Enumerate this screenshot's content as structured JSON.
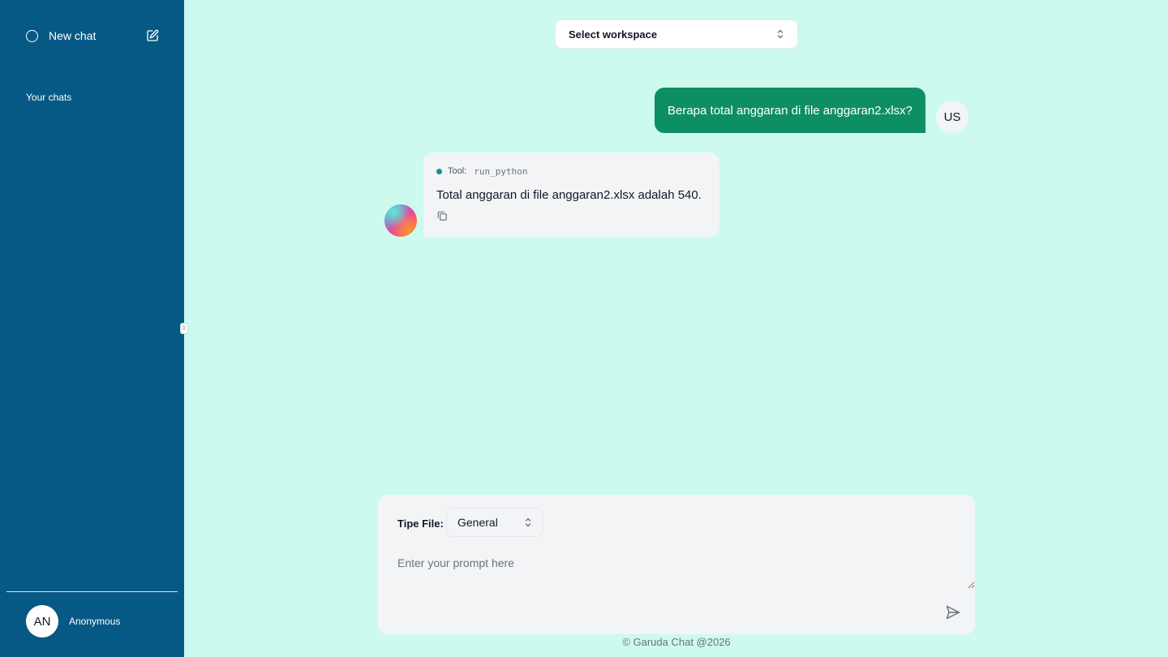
{
  "sidebar": {
    "new_chat_label": "New chat",
    "your_chats_label": "Your chats",
    "user": {
      "initials": "AN",
      "name": "Anonymous"
    },
    "background": "#075985"
  },
  "header": {
    "workspace_label": "Select workspace"
  },
  "conversation": {
    "user_message": {
      "text": "Berapa total anggaran di file anggaran2.xlsx?",
      "badge": "US",
      "color": "#0e8f63"
    },
    "assistant_message": {
      "tool_label": "Tool:",
      "tool_name": "run_python",
      "text": "Total anggaran di file anggaran2.xlsx adalah 540."
    }
  },
  "composer": {
    "file_type_label": "Tipe File:",
    "file_type_value": "General",
    "prompt_placeholder": "Enter your prompt here"
  },
  "footer": {
    "text": "© Garuda Chat @2026"
  },
  "icons": [
    "circle-icon",
    "edit-icon",
    "chevron-updown-icon",
    "copy-icon",
    "send-icon",
    "drag-handle-icon"
  ]
}
